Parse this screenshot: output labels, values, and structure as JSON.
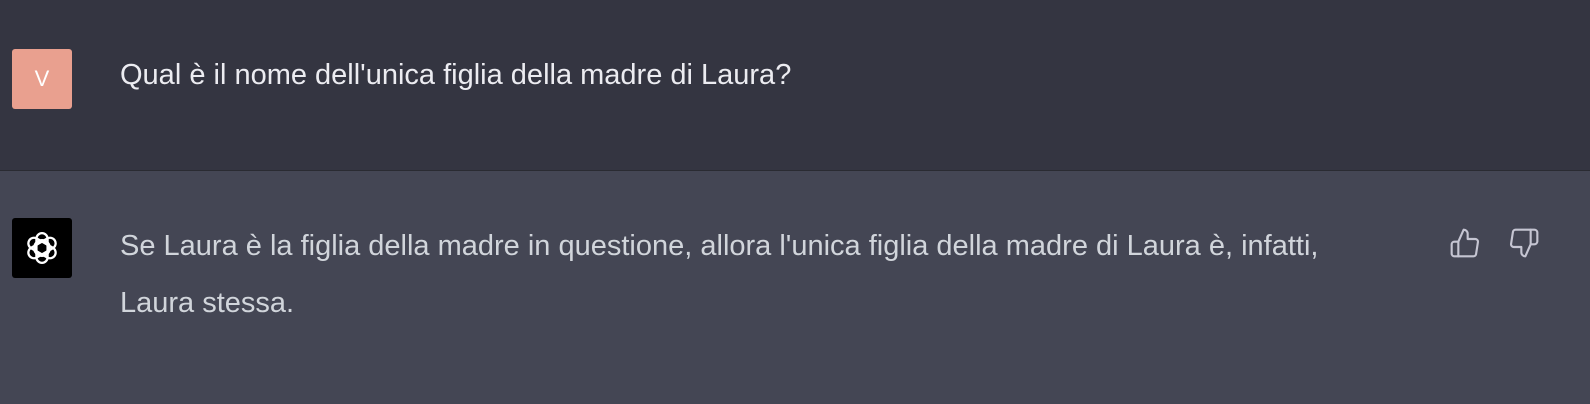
{
  "conversation": {
    "user_message": {
      "avatar_initial": "V",
      "avatar_color": "#e9a08f",
      "text": "Qual è il nome dell'unica figlia della madre di Laura?"
    },
    "assistant_message": {
      "avatar_icon": "openai-logo-icon",
      "avatar_color": "#000000",
      "text": "Se Laura è la figlia della madre in questione, allora l'unica figlia della madre di Laura è, infatti, Laura stessa."
    },
    "feedback": {
      "like_icon": "thumbs-up-icon",
      "dislike_icon": "thumbs-down-icon"
    }
  }
}
